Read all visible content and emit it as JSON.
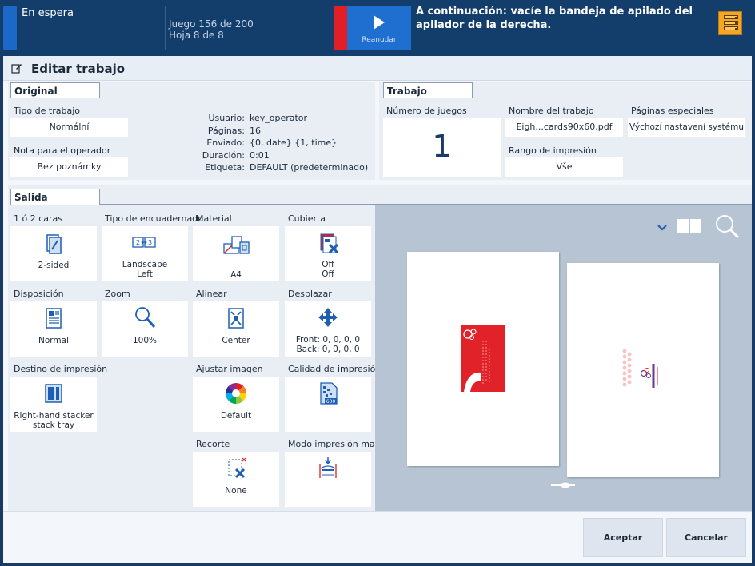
{
  "status_bar": {
    "status": "En espera",
    "job_line1": "Juego 156 de 200",
    "job_line2": "Hoja 8 de 8",
    "resume_label": "Reanudar",
    "message": "A continuación: vacíe la bandeja de apilado del apilador de la derecha.",
    "stacker_icon": "stacker-tray-icon"
  },
  "dialog": {
    "title": "Editar trabajo",
    "title_icon": "edit-icon"
  },
  "original": {
    "tab": "Original",
    "job_type_label": "Tipo de trabajo",
    "job_type_value": "Normální",
    "operator_note_label": "Nota para el operador",
    "operator_note_value": "Bez poznámky",
    "info": [
      {
        "key": "Usuario:",
        "value": "key_operator"
      },
      {
        "key": "Páginas:",
        "value": "16"
      },
      {
        "key": "Enviado:",
        "value": "{0, date} {1, time}"
      },
      {
        "key": "Duración:",
        "value": "0:01"
      },
      {
        "key": "Etiqueta:",
        "value": "DEFAULT (predeterminado)"
      }
    ]
  },
  "job": {
    "tab": "Trabajo",
    "copies_label": "Número de juegos",
    "copies_value": "1",
    "name_label": "Nombre del trabajo",
    "name_value": "Eigh...cards90x60.pdf",
    "special_pages_label": "Páginas especiales",
    "special_pages_value": "Výchozí nastavení systému",
    "print_range_label": "Rango de impresión",
    "print_range_value": "Vše"
  },
  "output": {
    "tab": "Salida",
    "tiles": {
      "sides": {
        "label": "1 ó 2 caras",
        "value": "2-sided",
        "icon": "duplex-icon"
      },
      "binding": {
        "label": "Tipo de encuadernado",
        "value1": "Landscape",
        "value2": "Left",
        "icon": "binding-icon"
      },
      "media": {
        "label": "Material",
        "value": "A4",
        "icon": "media-icon"
      },
      "cover": {
        "label": "Cubierta",
        "value1": "Off",
        "value2": "Off",
        "icon": "cover-off-icon"
      },
      "layout": {
        "label": "Disposición",
        "value": "Normal",
        "icon": "layout-icon"
      },
      "zoom": {
        "label": "Zoom",
        "value": "100%",
        "icon": "zoom-icon"
      },
      "align": {
        "label": "Alinear",
        "value": "Center",
        "icon": "align-center-icon"
      },
      "shift": {
        "label": "Desplazar",
        "value1": "Front: 0, 0, 0, 0",
        "value2": "Back: 0, 0, 0, 0",
        "icon": "shift-icon"
      },
      "destination": {
        "label": "Destino de impresión",
        "value1": "Right-hand stacker",
        "value2": "stack tray",
        "icon": "stacker-icon"
      },
      "image_adjust": {
        "label": "Ajustar imagen",
        "value": "Default",
        "icon": "color-wheel-icon"
      },
      "print_quality": {
        "label": "Calidad de impresión",
        "value": "",
        "icon": "print-quality-icon"
      },
      "trim": {
        "label": "Recorte",
        "value": "None",
        "icon": "trim-off-icon"
      },
      "media_mode": {
        "label": "Modo impresión mat...",
        "value": "",
        "icon": "media-print-mode-icon"
      }
    }
  },
  "preview": {
    "dropdown_icon": "chevron-down-icon",
    "book_icon": "book-view-icon",
    "magnifier_icon": "magnifier-icon",
    "slider_icon": "page-slider-icon"
  },
  "footer": {
    "accept": "Aceptar",
    "cancel": "Cancelar"
  },
  "colors": {
    "topbar": "#133e6b",
    "accent_blue": "#1b68c6",
    "alert_red": "#e21e26",
    "stacker_orange": "#f5a623",
    "icon_blue": "#1e5fb4"
  }
}
